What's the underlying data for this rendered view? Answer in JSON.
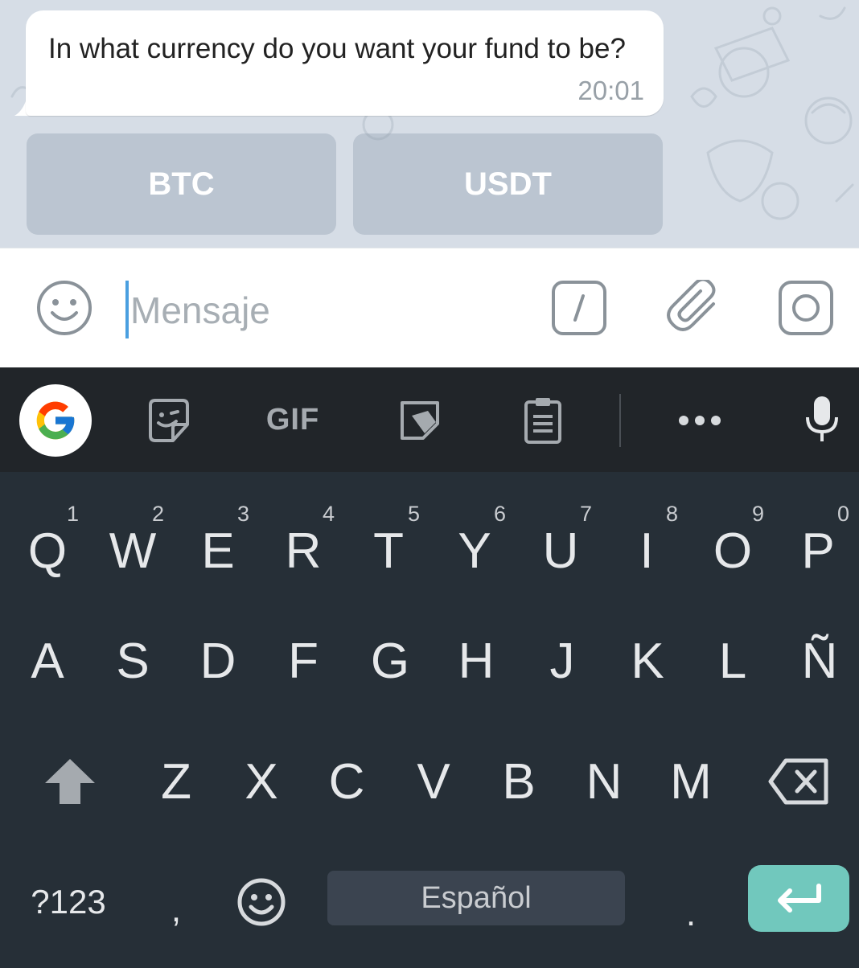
{
  "chat": {
    "message_text": "In what currency do you want your fund to be?",
    "message_time": "20:01",
    "reply_buttons": [
      "BTC",
      "USDT"
    ]
  },
  "input_bar": {
    "placeholder": "Mensaje",
    "icons": [
      "emoji-icon",
      "bot-command-icon",
      "attach-icon",
      "camera-icon"
    ]
  },
  "keyboard_toolbar": {
    "gif_label": "GIF",
    "icons": [
      "google-icon",
      "sticker-icon",
      "gif-icon",
      "note-icon",
      "clipboard-icon",
      "more-icon",
      "microphone-icon"
    ]
  },
  "keyboard": {
    "row1": [
      {
        "label": "Q",
        "hint": "1"
      },
      {
        "label": "W",
        "hint": "2"
      },
      {
        "label": "E",
        "hint": "3"
      },
      {
        "label": "R",
        "hint": "4"
      },
      {
        "label": "T",
        "hint": "5"
      },
      {
        "label": "Y",
        "hint": "6"
      },
      {
        "label": "U",
        "hint": "7"
      },
      {
        "label": "I",
        "hint": "8"
      },
      {
        "label": "O",
        "hint": "9"
      },
      {
        "label": "P",
        "hint": "0"
      }
    ],
    "row2": [
      "A",
      "S",
      "D",
      "F",
      "G",
      "H",
      "J",
      "K",
      "L",
      "Ñ"
    ],
    "row3": [
      "Z",
      "X",
      "C",
      "V",
      "B",
      "N",
      "M"
    ],
    "symbols_label": "?123",
    "comma_label": ",",
    "space_label": "Español",
    "period_label": ".",
    "colors": {
      "background": "#262f37",
      "toolbar": "#212529",
      "enter_key": "#71c8bd",
      "space_key": "#3b4450"
    }
  }
}
